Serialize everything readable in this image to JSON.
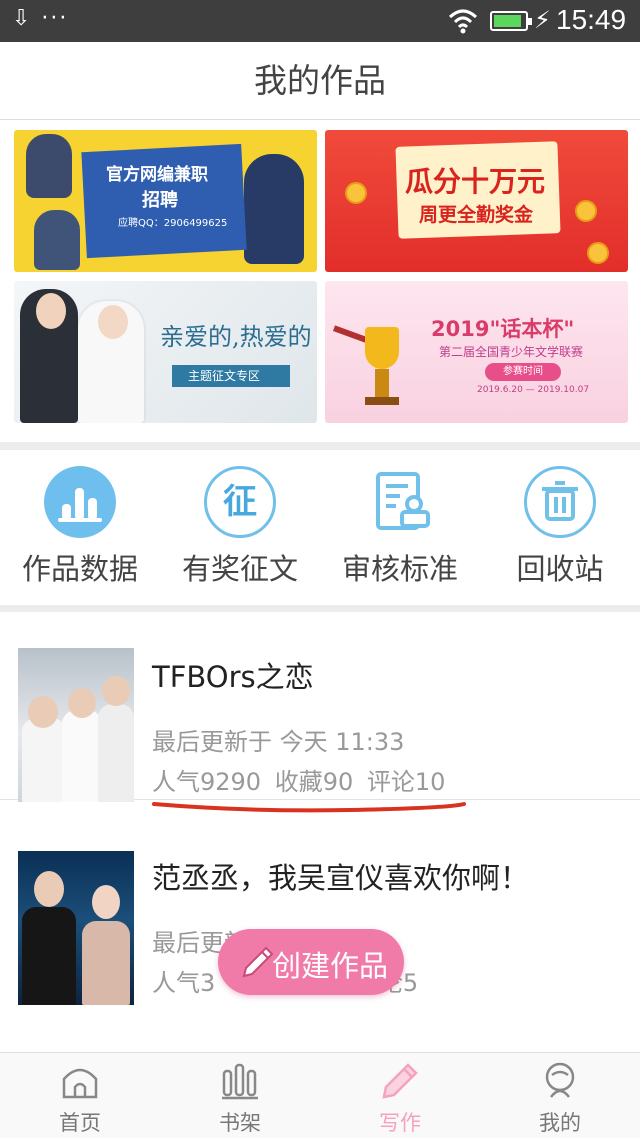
{
  "status_bar": {
    "left_icons": "⇩ ···",
    "time": "15:49"
  },
  "header": {
    "title": "我的作品"
  },
  "banners": [
    {
      "name": "recruit",
      "title": "官方网编兼职",
      "subtitle": "招聘",
      "detail": "应聘QQ：2906499625"
    },
    {
      "name": "bonus",
      "title": "瓜分十万元",
      "subtitle": "周更全勤奖金"
    },
    {
      "name": "theme",
      "title": "亲爱的,热爱的",
      "subtitle": "主题征文专区"
    },
    {
      "name": "contest",
      "title": "2019\"话本杯\"",
      "subtitle": "第二届全国青少年文学联赛",
      "badge": "参赛时间",
      "dates": "2019.6.20 — 2019.10.07"
    }
  ],
  "quick_menu": [
    {
      "label": "作品数据",
      "icon": "bar-chart-icon"
    },
    {
      "label": "有奖征文",
      "icon": "contest-icon",
      "glyph": "征"
    },
    {
      "label": "审核标准",
      "icon": "document-review-icon"
    },
    {
      "label": "回收站",
      "icon": "trash-icon"
    }
  ],
  "works": [
    {
      "title": "TFBOrs之恋",
      "updated": "最后更新于 今天 11:33",
      "popularity": "人气9290",
      "favorites": "收藏90",
      "comments": "评论10"
    },
    {
      "title": "范丞丞，我吴宣仪喜欢你啊！",
      "updated": "最后更新于 07.10",
      "popularity": "人气3",
      "comments": "论5"
    }
  ],
  "create_button": {
    "label": "创建作品"
  },
  "tabbar": [
    {
      "label": "首页",
      "icon": "home-icon"
    },
    {
      "label": "书架",
      "icon": "bookshelf-icon"
    },
    {
      "label": "写作",
      "icon": "pen-icon",
      "active": true
    },
    {
      "label": "我的",
      "icon": "profile-icon"
    }
  ],
  "colors": {
    "accent_pink": "#f07aa8",
    "accent_blue": "#6ebfee",
    "underline_red": "#d9321f"
  }
}
